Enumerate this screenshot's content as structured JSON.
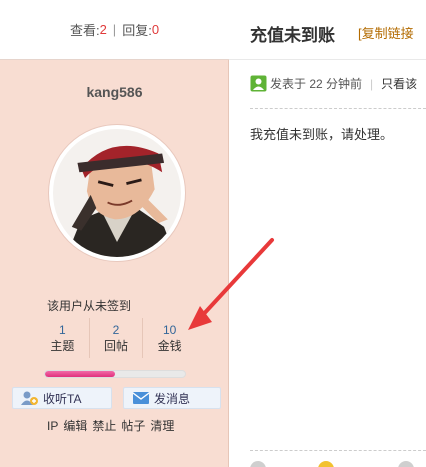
{
  "stats": {
    "views_label": "查看:",
    "views": "2",
    "replies_label": "回复:",
    "replies": "0"
  },
  "thread": {
    "title": "充值未到账",
    "copy_link": "[复制链接"
  },
  "author": {
    "username": "kang586",
    "sign_status": "该用户从未签到",
    "counters": [
      {
        "value": "1",
        "label": "主题"
      },
      {
        "value": "2",
        "label": "回帖"
      },
      {
        "value": "10",
        "label": "金钱"
      }
    ],
    "progress_fraction": 0.5,
    "follow_button": "收听TA",
    "message_button": "发消息",
    "admin_links": [
      "IP",
      "编辑",
      "禁止",
      "帖子",
      "清理"
    ]
  },
  "post": {
    "posted_time": "发表于 22 分钟前",
    "only_author": "只看该",
    "content": "我充值未到账，请处理。"
  },
  "colors": {
    "sidebar_bg": "#f8ddd2",
    "annotation_arrow": "#e8393a",
    "count_accent": "#e03a3a"
  },
  "icons": {
    "user_online": "user-online-icon",
    "follow": "follow-user-icon",
    "message": "envelope-icon"
  }
}
